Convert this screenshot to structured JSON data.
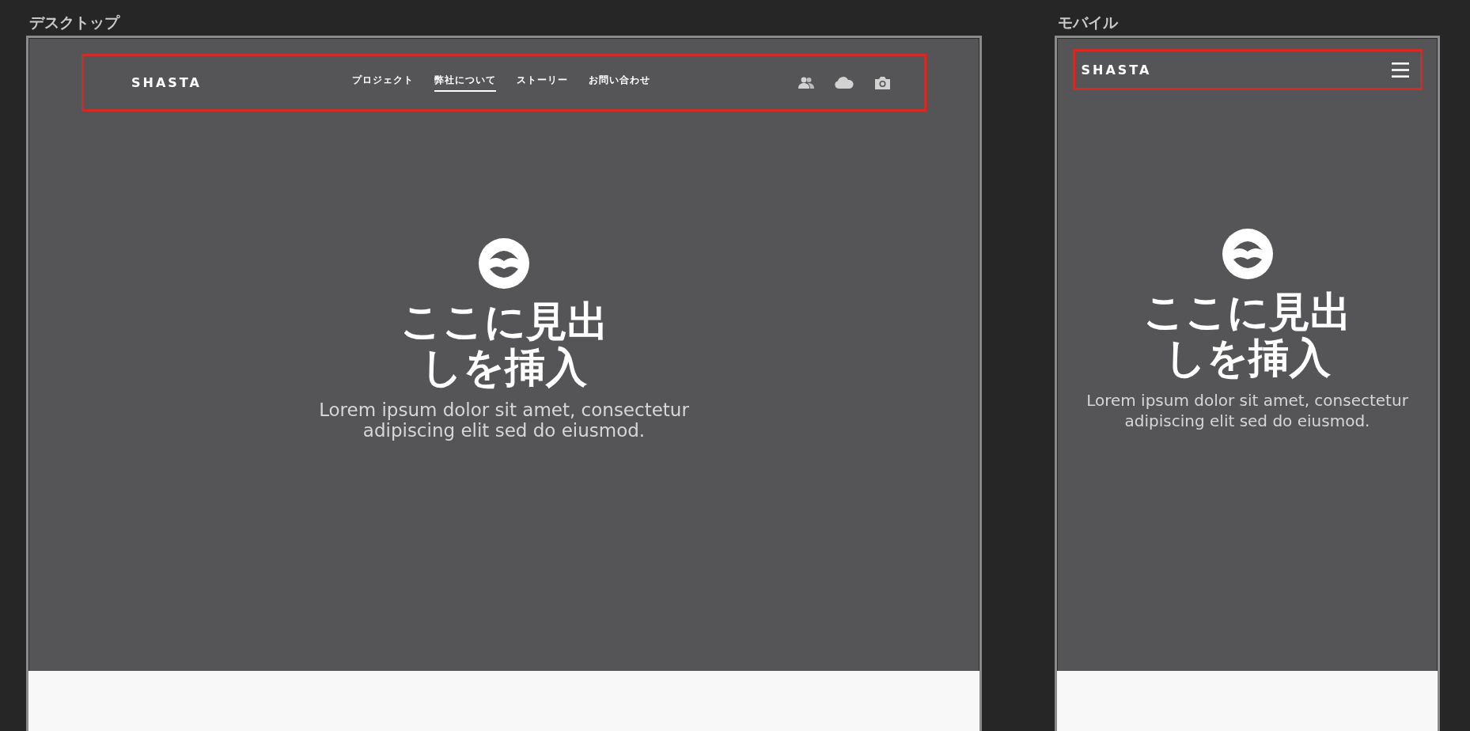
{
  "desktop": {
    "label": "デスクトップ",
    "header": {
      "logo": "SHASTA",
      "nav": [
        {
          "label": "プロジェクト",
          "selected": false
        },
        {
          "label": "弊社について",
          "selected": true
        },
        {
          "label": "ストーリー",
          "selected": false
        },
        {
          "label": "お問い合わせ",
          "selected": false
        }
      ]
    },
    "hero": {
      "heading_lines": [
        "ここに見出",
        "しを挿入"
      ],
      "body_lines": [
        "Lorem ipsum dolor sit amet, consectetur",
        "adipiscing elit sed do eiusmod."
      ]
    }
  },
  "mobile": {
    "label": "モバイル",
    "header": {
      "logo": "SHASTA"
    },
    "hero": {
      "heading_lines": [
        "ここに見出",
        "しを挿入"
      ],
      "body_lines": [
        "Lorem ipsum dolor sit amet, consectetur",
        "adipiscing elit sed do eiusmod."
      ]
    }
  }
}
